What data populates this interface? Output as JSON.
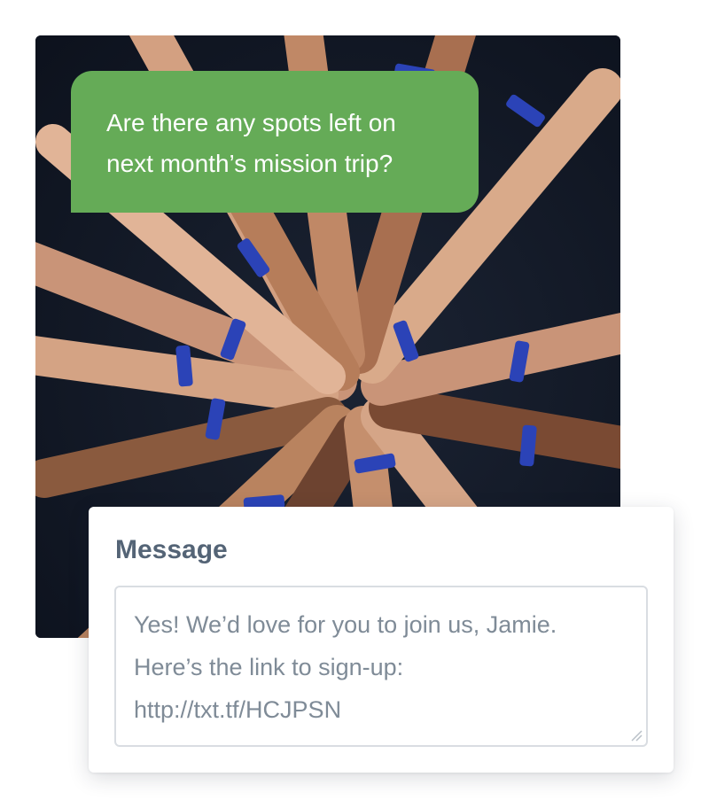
{
  "photo": {
    "alt_icon": "hands-together-photo"
  },
  "chat": {
    "incoming_line_1": "Are there any spots left on",
    "incoming_line_2": "next month’s mission trip?",
    "bubble_color": "#65ab57"
  },
  "composer": {
    "title": "Message",
    "body_lines": [
      "Yes! We’d love for you to join us, Jamie.",
      "Here’s the link to sign-up:",
      "http://txt.tf/HCJPSN"
    ]
  }
}
